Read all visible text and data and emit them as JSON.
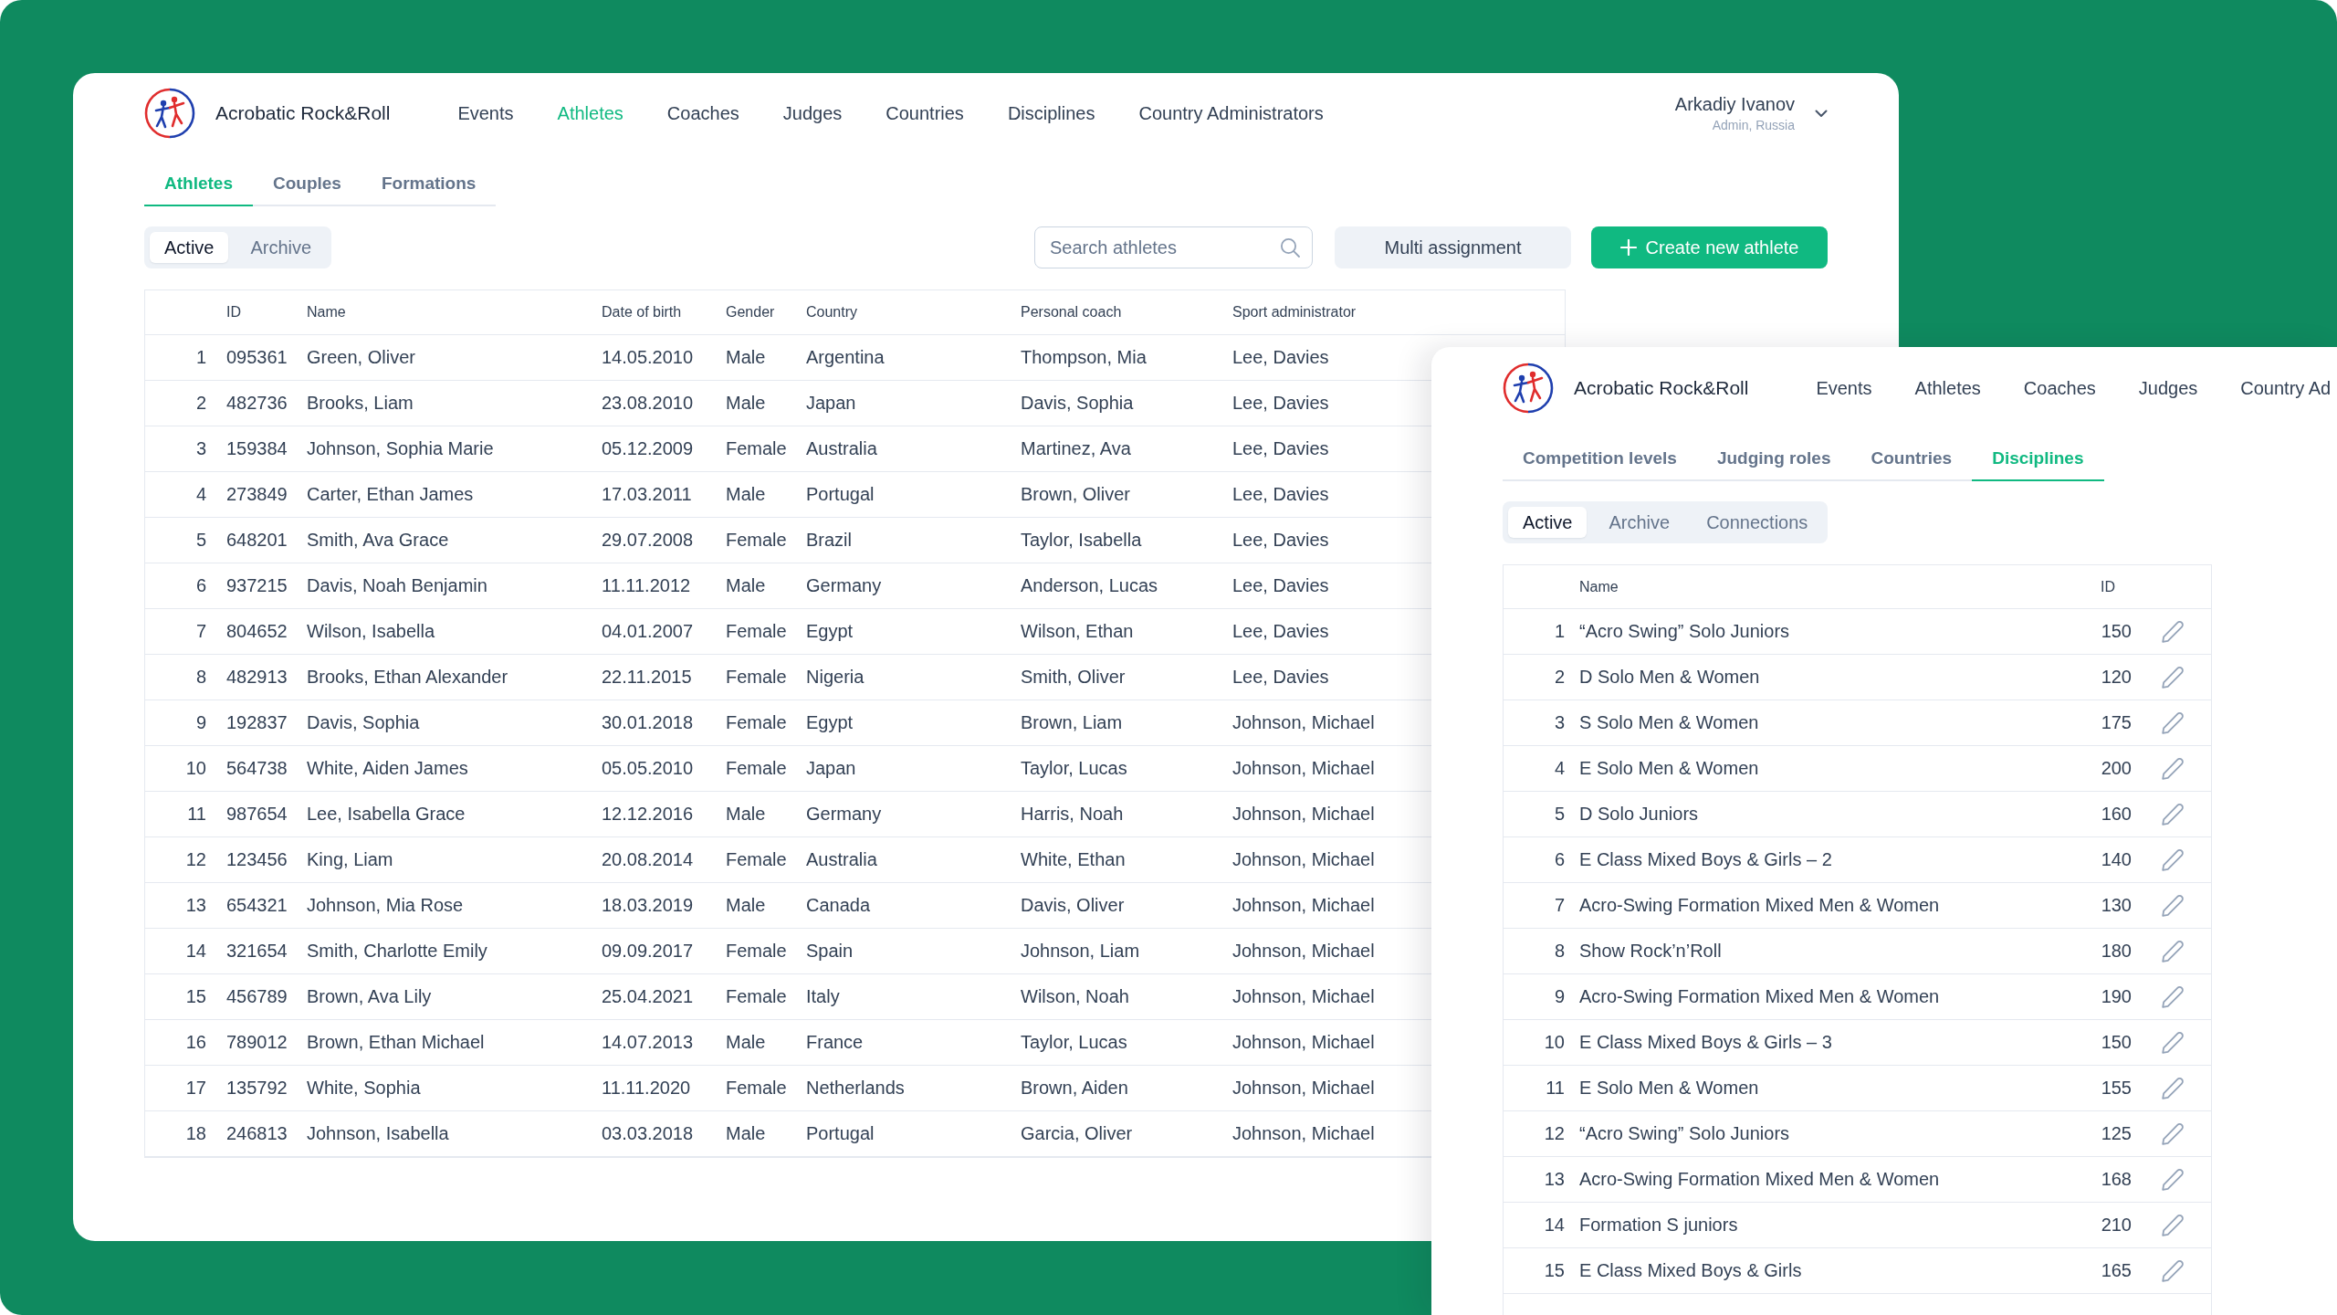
{
  "athletes_window": {
    "app_title": "Acrobatic Rock&Roll",
    "nav": [
      {
        "label": "Events",
        "selected": false
      },
      {
        "label": "Athletes",
        "selected": true
      },
      {
        "label": "Coaches",
        "selected": false
      },
      {
        "label": "Judges",
        "selected": false
      },
      {
        "label": "Countries",
        "selected": false
      },
      {
        "label": "Disciplines",
        "selected": false
      },
      {
        "label": "Country Administrators",
        "selected": false
      }
    ],
    "user": {
      "name": "Arkadiy Ivanov",
      "role": "Admin, Russia"
    },
    "tabs": [
      {
        "label": "Athletes",
        "selected": true
      },
      {
        "label": "Couples",
        "selected": false
      },
      {
        "label": "Formations",
        "selected": false
      }
    ],
    "filters": [
      {
        "label": "Active",
        "selected": true
      },
      {
        "label": "Archive",
        "selected": false
      }
    ],
    "search": {
      "placeholder": "Search athletes"
    },
    "buttons": [
      {
        "label": "Multi assignment",
        "kind": "secondary"
      },
      {
        "label": "Create new athlete",
        "kind": "primary"
      }
    ],
    "table": {
      "columns": [
        "ID",
        "Name",
        "Date of birth",
        "Gender",
        "Country",
        "Personal coach",
        "Sport administrator"
      ],
      "rows": [
        {
          "number": "1",
          "cells": [
            "095361",
            "Green, Oliver",
            "14.05.2010",
            "Male",
            "Argentina",
            "Thompson, Mia",
            "Lee, Davies"
          ]
        },
        {
          "number": "2",
          "cells": [
            "482736",
            "Brooks, Liam",
            "23.08.2010",
            "Male",
            "Japan",
            "Davis, Sophia",
            "Lee, Davies"
          ]
        },
        {
          "number": "3",
          "cells": [
            "159384",
            "Johnson, Sophia Marie",
            "05.12.2009",
            "Female",
            "Australia",
            "Martinez, Ava",
            "Lee, Davies"
          ]
        },
        {
          "number": "4",
          "cells": [
            "273849",
            "Carter, Ethan James",
            "17.03.2011",
            "Male",
            "Portugal",
            "Brown, Oliver",
            "Lee, Davies"
          ]
        },
        {
          "number": "5",
          "cells": [
            "648201",
            "Smith, Ava Grace",
            "29.07.2008",
            "Female",
            "Brazil",
            "Taylor, Isabella",
            "Lee, Davies"
          ]
        },
        {
          "number": "6",
          "cells": [
            "937215",
            "Davis, Noah Benjamin",
            "11.11.2012",
            "Male",
            "Germany",
            "Anderson, Lucas",
            "Lee, Davies"
          ]
        },
        {
          "number": "7",
          "cells": [
            "804652",
            "Wilson, Isabella",
            "04.01.2007",
            "Female",
            "Egypt",
            "Wilson, Ethan",
            "Lee, Davies"
          ]
        },
        {
          "number": "8",
          "cells": [
            "482913",
            "Brooks, Ethan Alexander",
            "22.11.2015",
            "Female",
            "Nigeria",
            "Smith, Oliver",
            "Lee, Davies"
          ]
        },
        {
          "number": "9",
          "cells": [
            "192837",
            "Davis, Sophia",
            "30.01.2018",
            "Female",
            "Egypt",
            "Brown, Liam",
            "Johnson, Michael"
          ]
        },
        {
          "number": "10",
          "cells": [
            "564738",
            "White, Aiden James",
            "05.05.2010",
            "Female",
            "Japan",
            "Taylor, Lucas",
            "Johnson, Michael"
          ]
        },
        {
          "number": "11",
          "cells": [
            "987654",
            "Lee, Isabella Grace",
            "12.12.2016",
            "Male",
            "Germany",
            "Harris, Noah",
            "Johnson, Michael"
          ]
        },
        {
          "number": "12",
          "cells": [
            "123456",
            "King, Liam",
            "20.08.2014",
            "Female",
            "Australia",
            "White, Ethan",
            "Johnson, Michael"
          ]
        },
        {
          "number": "13",
          "cells": [
            "654321",
            "Johnson, Mia Rose",
            "18.03.2019",
            "Male",
            "Canada",
            "Davis, Oliver",
            "Johnson, Michael"
          ]
        },
        {
          "number": "14",
          "cells": [
            "321654",
            "Smith, Charlotte Emily",
            "09.09.2017",
            "Female",
            "Spain",
            "Johnson, Liam",
            "Johnson, Michael"
          ]
        },
        {
          "number": "15",
          "cells": [
            "456789",
            "Brown, Ava Lily",
            "25.04.2021",
            "Female",
            "Italy",
            "Wilson, Noah",
            "Johnson, Michael"
          ]
        },
        {
          "number": "16",
          "cells": [
            "789012",
            "Brown, Ethan Michael",
            "14.07.2013",
            "Male",
            "France",
            "Taylor, Lucas",
            "Johnson, Michael"
          ]
        },
        {
          "number": "17",
          "cells": [
            "135792",
            "White, Sophia",
            "11.11.2020",
            "Female",
            "Netherlands",
            "Brown, Aiden",
            "Johnson, Michael"
          ]
        },
        {
          "number": "18",
          "cells": [
            "246813",
            "Johnson, Isabella",
            "03.03.2018",
            "Male",
            "Portugal",
            "Garcia, Oliver",
            "Johnson, Michael"
          ]
        }
      ]
    }
  },
  "disciplines_window": {
    "app_title": "Acrobatic Rock&Roll",
    "nav": [
      {
        "label": "Events",
        "selected": false
      },
      {
        "label": "Athletes",
        "selected": false
      },
      {
        "label": "Coaches",
        "selected": false
      },
      {
        "label": "Judges",
        "selected": false
      },
      {
        "label": "Country Ad",
        "selected": false
      }
    ],
    "tabs": [
      {
        "label": "Competition levels",
        "selected": false
      },
      {
        "label": "Judging roles",
        "selected": false
      },
      {
        "label": "Countries",
        "selected": false
      },
      {
        "label": "Disciplines",
        "selected": true
      }
    ],
    "filters": [
      {
        "label": "Active",
        "selected": true
      },
      {
        "label": "Archive",
        "selected": false
      },
      {
        "label": "Connections",
        "selected": false
      }
    ],
    "table": {
      "columns": [
        "Name",
        "ID"
      ],
      "rows": [
        {
          "number": "1",
          "cells": [
            "“Acro Swing” Solo Juniors",
            "150"
          ]
        },
        {
          "number": "2",
          "cells": [
            "D Solo Men & Women",
            "120"
          ]
        },
        {
          "number": "3",
          "cells": [
            "S Solo Men & Women",
            "175"
          ]
        },
        {
          "number": "4",
          "cells": [
            "E Solo Men & Women",
            "200"
          ]
        },
        {
          "number": "5",
          "cells": [
            "D Solo Juniors",
            "160"
          ]
        },
        {
          "number": "6",
          "cells": [
            "E Class Mixed Boys & Girls – 2",
            "140"
          ]
        },
        {
          "number": "7",
          "cells": [
            "Acro-Swing Formation Mixed Men & Women",
            "130"
          ]
        },
        {
          "number": "8",
          "cells": [
            "Show Rock’n’Roll",
            "180"
          ]
        },
        {
          "number": "9",
          "cells": [
            "Acro-Swing Formation Mixed Men & Women",
            "190"
          ]
        },
        {
          "number": "10",
          "cells": [
            "E Class Mixed Boys & Girls – 3",
            "150"
          ]
        },
        {
          "number": "11",
          "cells": [
            "E Solo Men & Women",
            "155"
          ]
        },
        {
          "number": "12",
          "cells": [
            "“Acro Swing” Solo Juniors",
            "125"
          ]
        },
        {
          "number": "13",
          "cells": [
            "Acro-Swing Formation Mixed Men & Women",
            "168"
          ]
        },
        {
          "number": "14",
          "cells": [
            "Formation S juniors",
            "210"
          ]
        },
        {
          "number": "15",
          "cells": [
            "E Class Mixed Boys & Girls",
            "165"
          ]
        }
      ]
    }
  }
}
